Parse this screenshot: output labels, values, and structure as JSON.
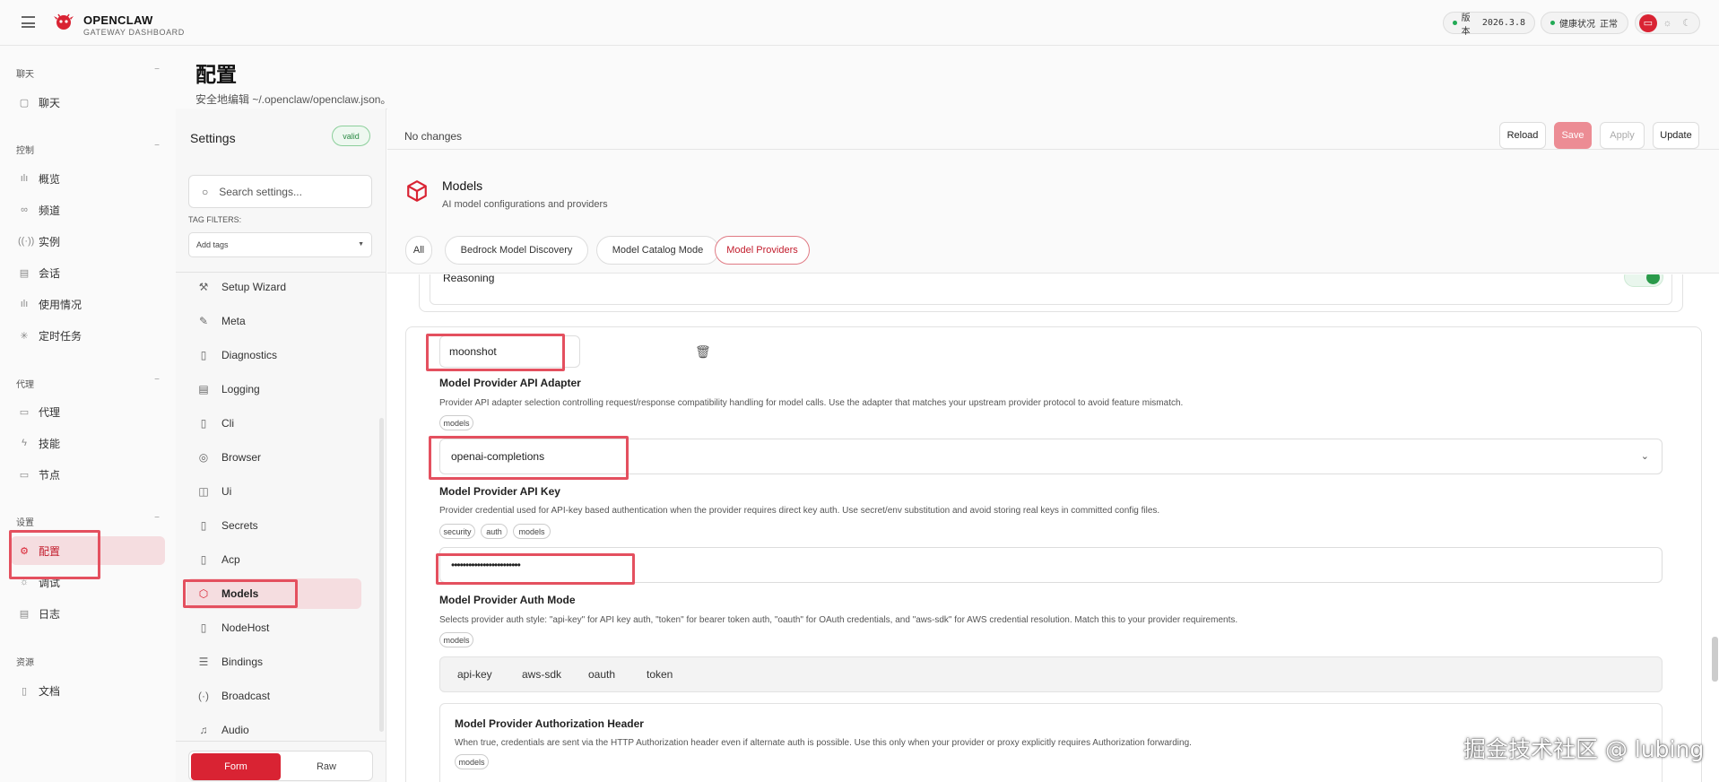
{
  "topbar": {
    "brand_title": "OPENCLAW",
    "brand_subtitle": "GATEWAY DASHBOARD",
    "version_label": "版本",
    "version_value": "2026.3.8",
    "health_label": "健康状况",
    "health_value": "正常",
    "accent": "#d92333",
    "status_color": "#22aa55"
  },
  "sidebar": {
    "groups": [
      {
        "title": "聊天",
        "items": [
          {
            "label": "聊天",
            "icon": "chat-icon"
          }
        ]
      },
      {
        "title": "控制",
        "items": [
          {
            "label": "概览",
            "icon": "bar-chart-icon"
          },
          {
            "label": "频道",
            "icon": "link-icon"
          },
          {
            "label": "实例",
            "icon": "broadcast-icon"
          },
          {
            "label": "会话",
            "icon": "document-icon"
          },
          {
            "label": "使用情况",
            "icon": "bar-chart-icon"
          },
          {
            "label": "定时任务",
            "icon": "loader-icon"
          }
        ]
      },
      {
        "title": "代理",
        "items": [
          {
            "label": "代理",
            "icon": "folder-icon"
          },
          {
            "label": "技能",
            "icon": "zap-icon"
          },
          {
            "label": "节点",
            "icon": "monitor-icon"
          }
        ]
      },
      {
        "title": "设置",
        "items": [
          {
            "label": "配置",
            "icon": "gear-icon"
          },
          {
            "label": "调试",
            "icon": "bug-icon"
          },
          {
            "label": "日志",
            "icon": "file-text-icon"
          }
        ]
      },
      {
        "title": "资源",
        "items": [
          {
            "label": "文档",
            "icon": "book-icon"
          }
        ]
      }
    ],
    "collapse_glyph": "−"
  },
  "page": {
    "title": "配置",
    "subtitle": "安全地编辑 ~/.openclaw/openclaw.json。"
  },
  "settings_nav": {
    "title": "Settings",
    "valid_badge": "valid",
    "search_placeholder": "Search settings...",
    "tag_filters_label": "TAG FILTERS:",
    "tags_placeholder": "Add tags",
    "sections": [
      {
        "label": "Setup Wizard",
        "icon": "wand-icon"
      },
      {
        "label": "Meta",
        "icon": "pen-icon"
      },
      {
        "label": "Diagnostics",
        "icon": "file-icon"
      },
      {
        "label": "Logging",
        "icon": "file-lines-icon"
      },
      {
        "label": "Cli",
        "icon": "file-icon"
      },
      {
        "label": "Browser",
        "icon": "chrome-icon"
      },
      {
        "label": "Ui",
        "icon": "layout-icon"
      },
      {
        "label": "Secrets",
        "icon": "file-icon"
      },
      {
        "label": "Acp",
        "icon": "file-icon"
      },
      {
        "label": "Models",
        "icon": "cube-icon"
      },
      {
        "label": "NodeHost",
        "icon": "file-icon"
      },
      {
        "label": "Bindings",
        "icon": "bindings-icon"
      },
      {
        "label": "Broadcast",
        "icon": "broadcast-icon"
      },
      {
        "label": "Audio",
        "icon": "music-icon"
      }
    ],
    "mode_form": "Form",
    "mode_raw": "Raw"
  },
  "toolbar": {
    "status": "No changes",
    "reload": "Reload",
    "save": "Save",
    "apply": "Apply",
    "update": "Update"
  },
  "section_header": {
    "title": "Models",
    "description": "AI model configurations and providers",
    "chips": [
      "All",
      "Bedrock Model Discovery",
      "Model Catalog Mode",
      "Model Providers"
    ]
  },
  "form": {
    "reasoning_label": "Reasoning",
    "reasoning_on": true,
    "provider_name": "moonshot",
    "api_adapter": {
      "label": "Model Provider API Adapter",
      "description": "Provider API adapter selection controlling request/response compatibility handling for model calls. Use the adapter that matches your upstream provider protocol to avoid feature mismatch.",
      "tags": [
        "models"
      ],
      "value": "openai-completions"
    },
    "api_key": {
      "label": "Model Provider API Key",
      "description": "Provider credential used for API-key based authentication when the provider requires direct key auth. Use secret/env substitution and avoid storing real keys in committed config files.",
      "tags": [
        "security",
        "auth",
        "models"
      ],
      "value": "••••••••••••••••••••••••"
    },
    "auth_mode": {
      "label": "Model Provider Auth Mode",
      "description": "Selects provider auth style: \"api-key\" for API key auth, \"token\" for bearer token auth, \"oauth\" for OAuth credentials, and \"aws-sdk\" for AWS credential resolution. Match this to your provider requirements.",
      "tags": [
        "models"
      ],
      "options": [
        "api-key",
        "aws-sdk",
        "oauth",
        "token"
      ]
    },
    "auth_header": {
      "label": "Model Provider Authorization Header",
      "description": "When true, credentials are sent via the HTTP Authorization header even if alternate auth is possible. Use this only when your provider or proxy explicitly requires Authorization forwarding.",
      "tags": [
        "models"
      ]
    }
  },
  "watermark": "掘金技术社区 @ lubing"
}
